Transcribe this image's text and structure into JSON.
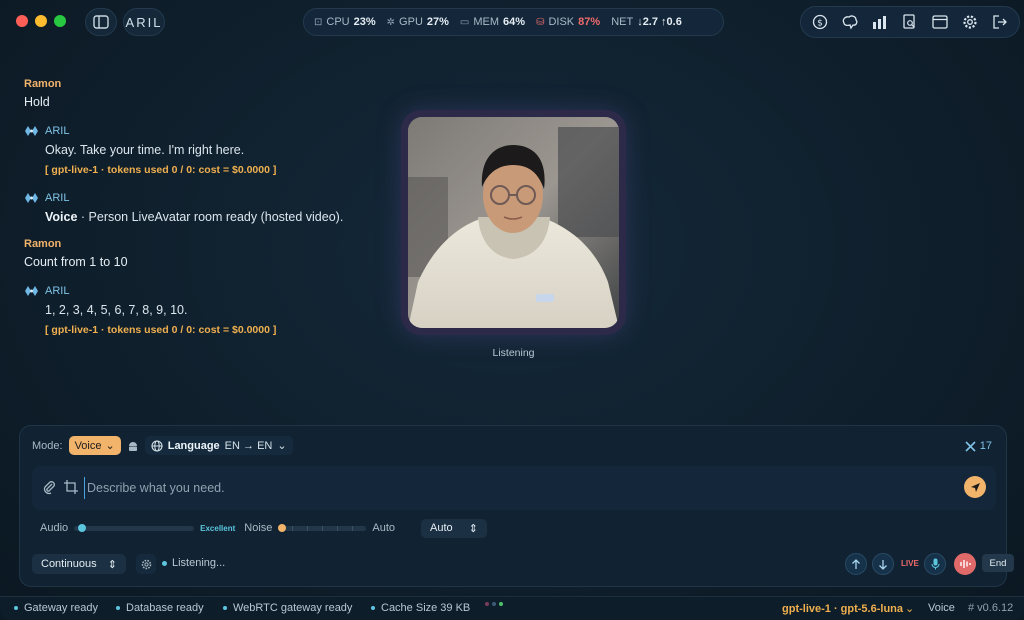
{
  "titlebar": {
    "brand": "ARIL",
    "stats": [
      {
        "label": "CPU",
        "value": "23%",
        "icon": "cpu-icon"
      },
      {
        "label": "GPU",
        "value": "27%",
        "icon": "gpu-icon"
      },
      {
        "label": "MEM",
        "value": "64%",
        "icon": "memory-icon"
      },
      {
        "label": "DISK",
        "value": "87%",
        "icon": "disk-icon",
        "color": "#ef6b6b"
      },
      {
        "label": "NET",
        "value": "↓2.7 ↑0.6"
      }
    ],
    "tools": [
      "dollar-icon",
      "brain-icon",
      "bars-chart-icon",
      "search-document-icon",
      "browser-window-icon",
      "gear-icon",
      "logout-icon"
    ]
  },
  "chat": {
    "m1": {
      "name": "Ramon",
      "text": "Hold"
    },
    "m2": {
      "name": "ARIL",
      "text": "Okay. Take your time. I'm right here.",
      "meta": "[ gpt-live-1 · tokens used 0 / 0: cost = $0.0000 ]"
    },
    "m3": {
      "name": "ARIL",
      "bold": "Voice",
      "text": " · Person LiveAvatar room ready (hosted video)."
    },
    "m4": {
      "name": "Ramon",
      "text": "Count from 1 to 10"
    },
    "m5": {
      "name": "ARIL",
      "text": "1, 2, 3, 4, 5, 6, 7, 8, 9, 10.",
      "meta": "[ gpt-live-1 · tokens used 0 / 0: cost = $0.0000 ]"
    }
  },
  "avatar": {
    "status": "Listening"
  },
  "composer": {
    "mode_label": "Mode:",
    "mode_value": "Voice",
    "language_label": "Language",
    "language_value": "EN → EN",
    "tool_count": "17",
    "placeholder": "Describe what you need.",
    "audio_label": "Audio",
    "audio_quality": "Excellent",
    "audio_level": 0.03,
    "noise_label": "Noise",
    "noise_mode": "Auto",
    "noise_select": "Auto",
    "continuous": "Continuous",
    "listening": "Listening...",
    "live": "LIVE",
    "end": "End",
    "accent": "#f2b36b"
  },
  "statusbar": {
    "items": [
      "Gateway ready",
      "Database ready",
      "WebRTC gateway ready",
      "Cache Size 39 KB"
    ],
    "model": "gpt-live-1 · gpt-5.6-luna",
    "mode": "Voice",
    "version": "# v0.6.12"
  }
}
